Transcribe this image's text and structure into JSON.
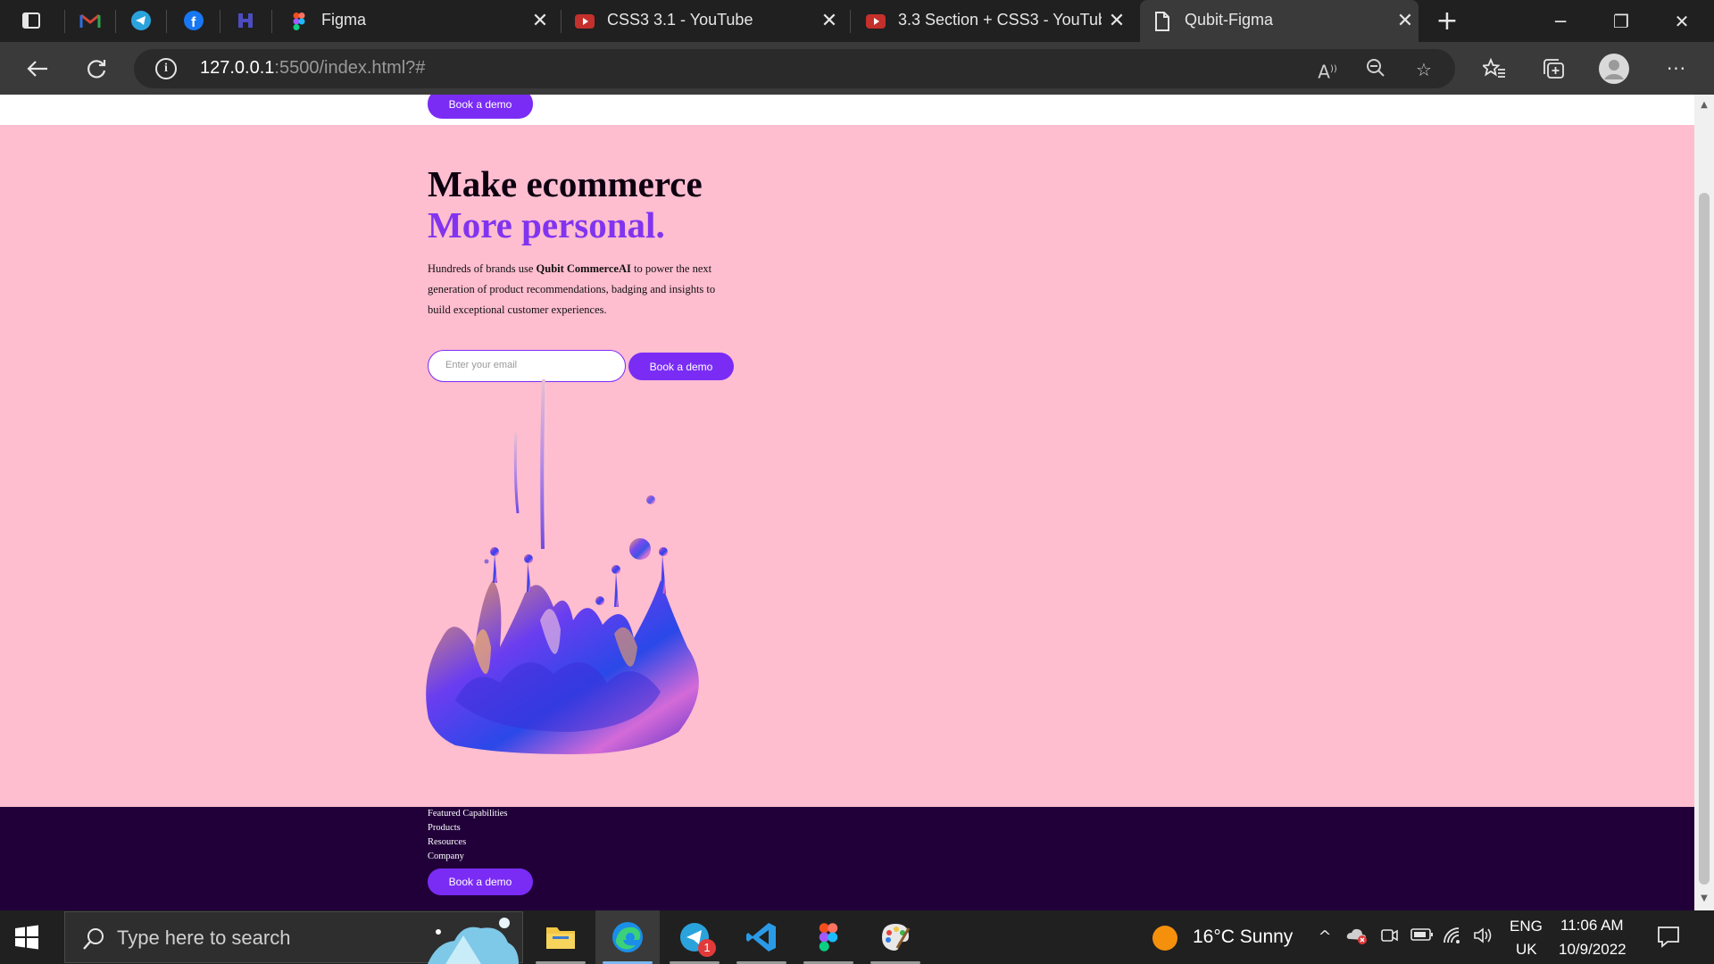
{
  "browser": {
    "pinned_tabs": [
      {
        "icon": "gmail-icon"
      },
      {
        "icon": "telegram-icon"
      },
      {
        "icon": "facebook-icon"
      },
      {
        "icon": "app-icon"
      }
    ],
    "tabs": [
      {
        "title": "Figma",
        "icon": "figma-icon"
      },
      {
        "title": "CSS3 3.1 - YouTube",
        "icon": "youtube-icon"
      },
      {
        "title": "3.3 Section + CSS3 - YouTube",
        "icon": "youtube-icon"
      },
      {
        "title": "Qubit-Figma",
        "icon": "page-icon",
        "active": true
      }
    ],
    "url_host": "127.0.0.1",
    "url_rest": ":5500/index.html?#"
  },
  "page": {
    "header_button": "Book a demo",
    "hero": {
      "title_line1": "Make ecommerce",
      "title_line2": "More personal.",
      "lead_before": "Hundreds of brands use ",
      "lead_brand": "Qubit CommerceAI",
      "lead_after": " to power the next generation of product recommendations, badging and insights to build exceptional customer experiences.",
      "email_placeholder": "Enter your email",
      "cta": "Book a demo"
    },
    "footer": {
      "links": [
        "Featured Capabilities",
        "Products",
        "Resources",
        "Company"
      ],
      "button": "Book a demo"
    },
    "colors": {
      "accent": "#7a2cf5",
      "hero_bg": "#ffbdd0",
      "footer_bg": "#21003a"
    }
  },
  "taskbar": {
    "search_placeholder": "Type here to search",
    "weather": "16°C  Sunny",
    "lang_line1": "ENG",
    "lang_line2": "UK",
    "time": "11:06 AM",
    "date": "10/9/2022",
    "telegram_badge": "1"
  }
}
